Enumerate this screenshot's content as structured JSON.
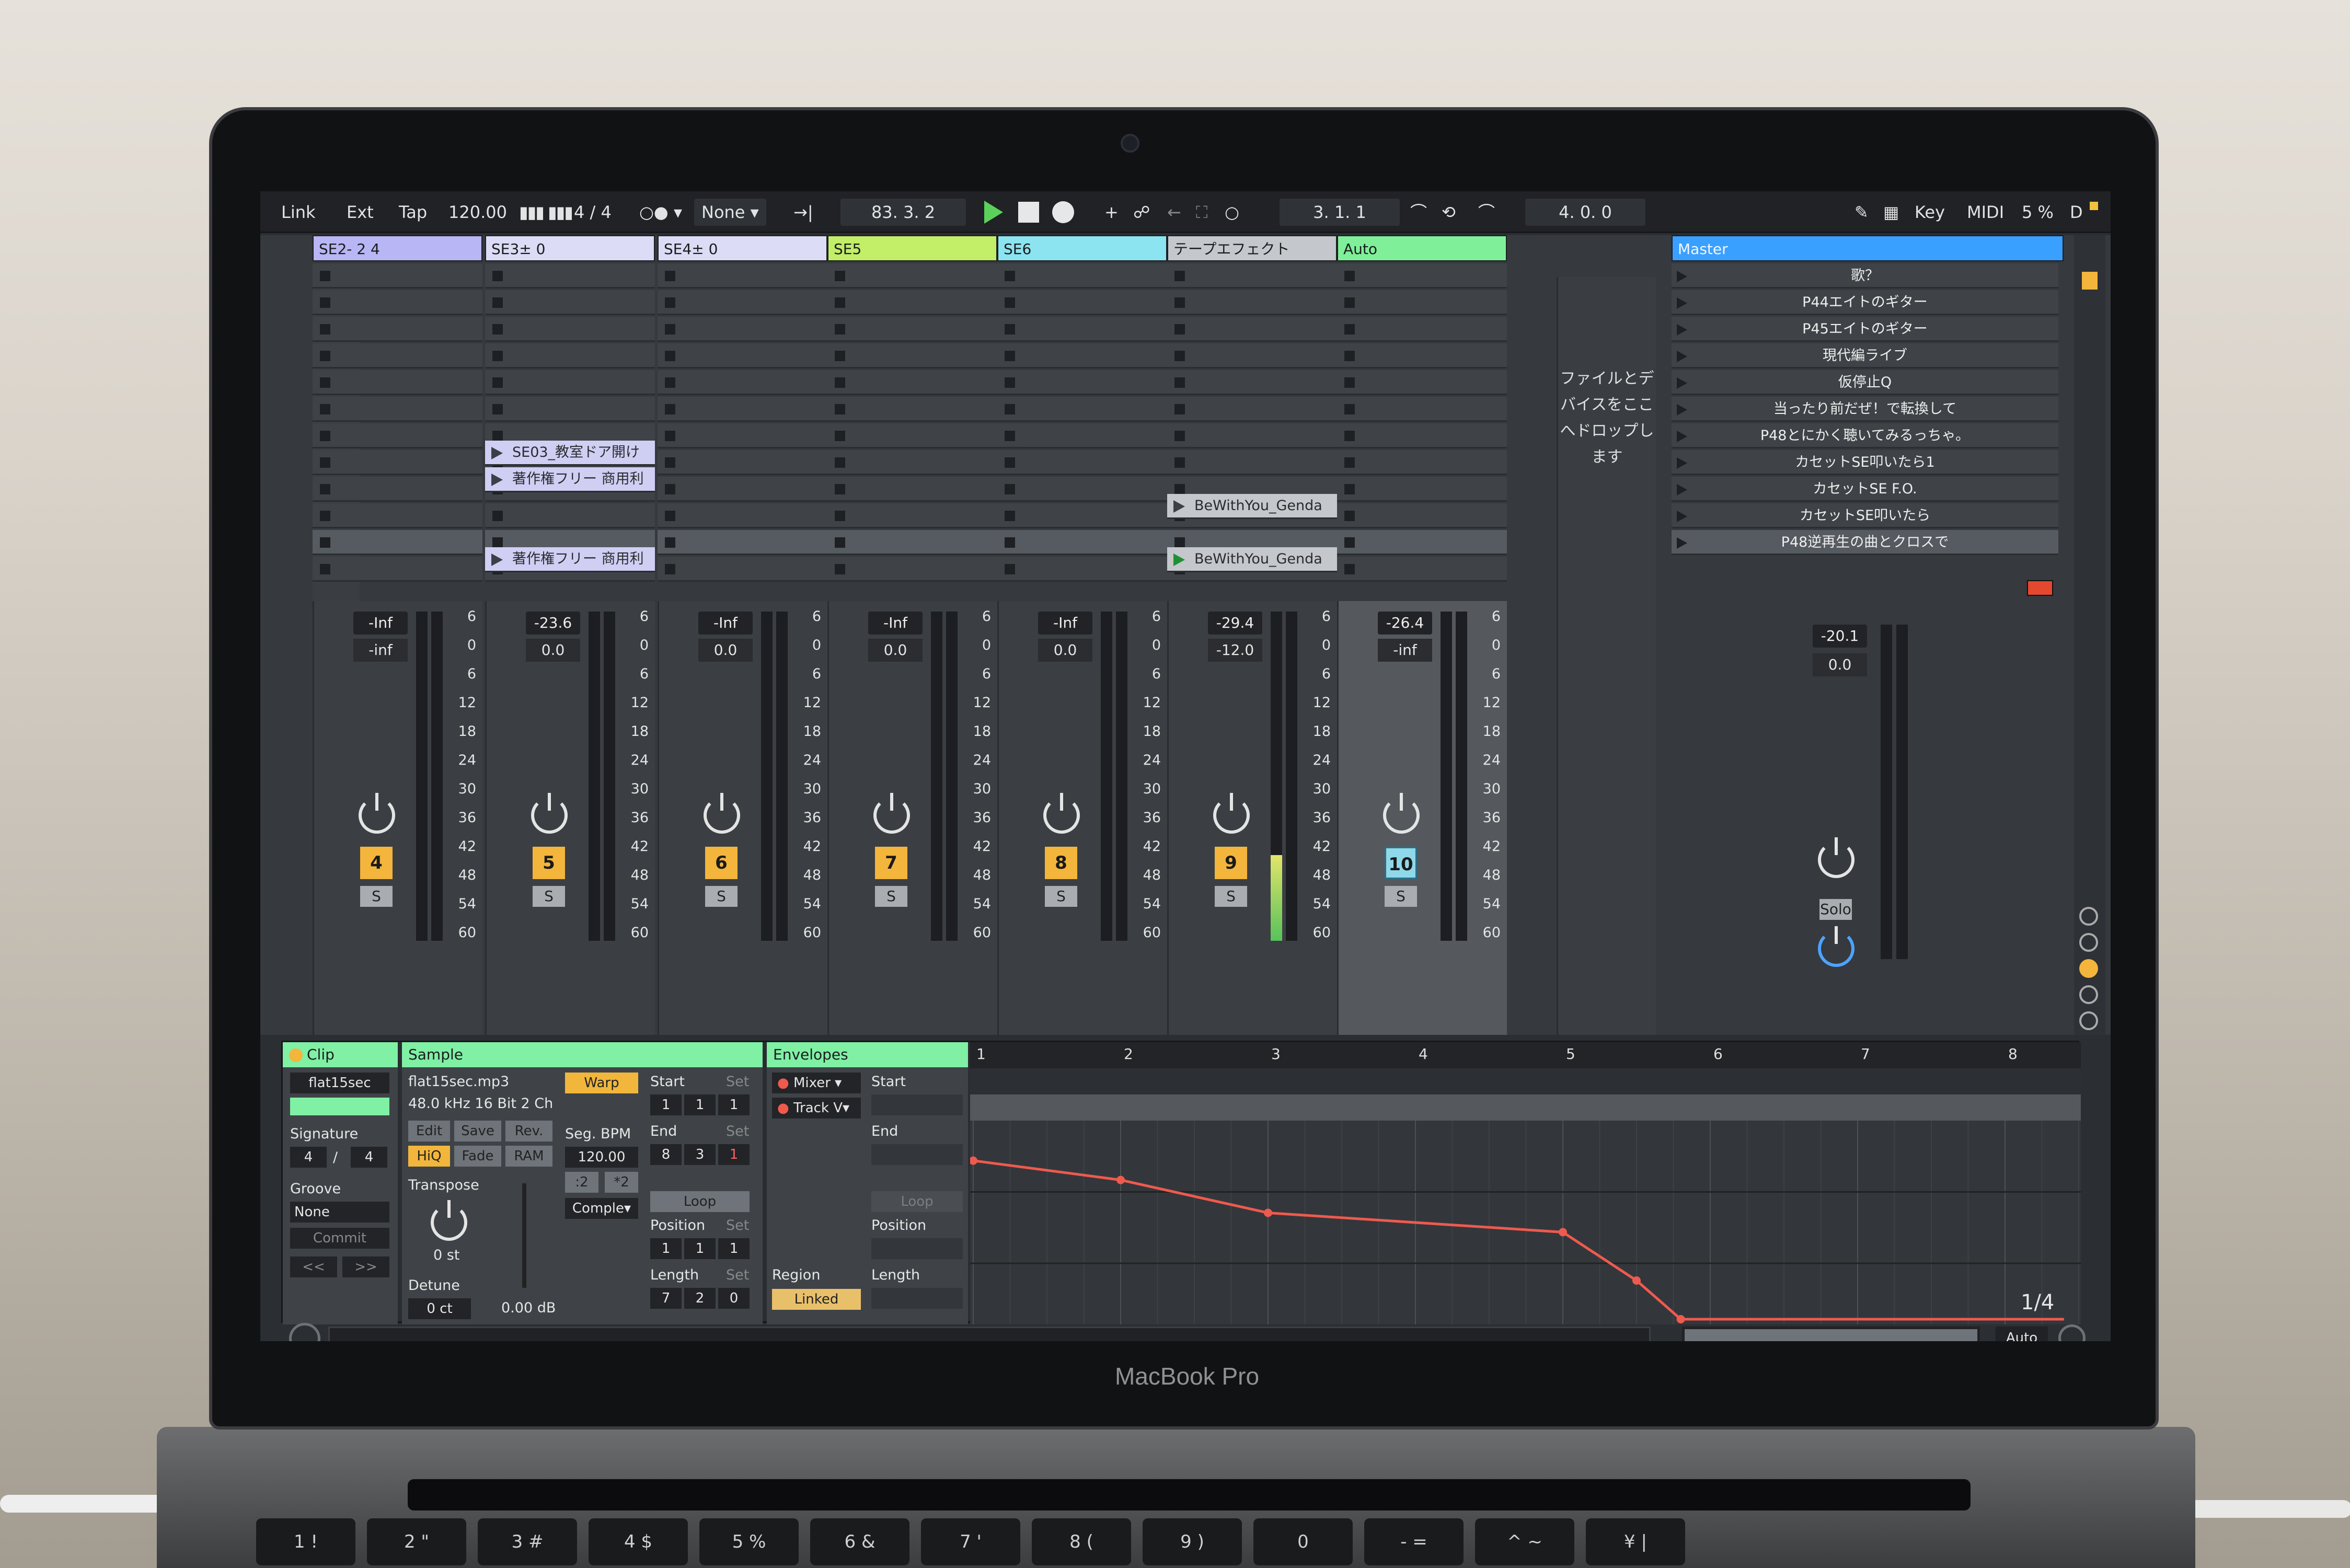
{
  "control_bar": {
    "link": "Link",
    "ext": "Ext",
    "tap": "Tap",
    "tempo": "120.00",
    "time_sig": "4 / 4",
    "quantize": "None",
    "arrangement_position": "83. 3. 2",
    "loop_start": "3. 1. 1",
    "loop_length": "4. 0. 0",
    "key": "Key",
    "midi": "MIDI",
    "cpu": "5 %",
    "disk": "D"
  },
  "tracks": [
    {
      "name": "SE2- 2 4",
      "color": "#b9b6f5",
      "number": "4",
      "vol_a": "-Inf",
      "vol_b": "-inf"
    },
    {
      "name": "SE3± 0",
      "color": "#dcdcf6",
      "number": "5",
      "vol_a": "-23.6",
      "vol_b": "0.0"
    },
    {
      "name": "SE4± 0",
      "color": "#dcdcf6",
      "number": "6",
      "vol_a": "-Inf",
      "vol_b": "0.0"
    },
    {
      "name": "SE5",
      "color": "#c2ee68",
      "number": "7",
      "vol_a": "-Inf",
      "vol_b": "0.0"
    },
    {
      "name": "SE6",
      "color": "#8ce4f1",
      "number": "8",
      "vol_a": "-Inf",
      "vol_b": "0.0"
    },
    {
      "name": "テープエフェクト",
      "color": "#c4c7cb",
      "number": "9",
      "vol_a": "-29.4",
      "vol_b": "-12.0"
    },
    {
      "name": "Auto",
      "color": "#7fef9a",
      "number": "10",
      "vol_a": "-26.4",
      "vol_b": "-inf"
    }
  ],
  "clips": [
    {
      "track": 1,
      "label": "SE03_教室ドア開け"
    },
    {
      "track": 1,
      "label": "著作権フリー 商用利"
    },
    {
      "track": 1,
      "label": "著作権フリー 商用利"
    },
    {
      "track": 5,
      "label": "BeWithYou_Genda"
    },
    {
      "track": 5,
      "label": "BeWithYou_Genda"
    }
  ],
  "scale_labels": [
    "6",
    "0",
    "6",
    "12",
    "18",
    "24",
    "30",
    "36",
    "42",
    "48",
    "54",
    "60"
  ],
  "dropzone_text": [
    "ファイルとデ",
    "バイスをここ",
    "へドロップし",
    "ます"
  ],
  "master": {
    "name": "Master",
    "vol_a": "-20.1",
    "vol_b": "0.0",
    "solo": "Solo",
    "scenes": [
      "歌？",
      "P44エイトのギター",
      "P45エイトのギター",
      "現代編ライブ",
      "仮停止Q",
      "当ったり前だぜ！で転換して",
      "P48とにかく聴いてみるっちゃ。",
      "カセットSE叩いたら1",
      "カセットSE F.O.",
      "カセットSE叩いたら",
      "P48逆再生の曲とクロスで"
    ]
  },
  "sends_label": "S",
  "clip_view": {
    "clip_header": "Clip",
    "clip_name": "flat15sec",
    "signature_label": "Signature",
    "sig_num": "4",
    "sig_slash": "/",
    "sig_den": "4",
    "groove_label": "Groove",
    "groove_value": "None",
    "commit": "Commit",
    "nav_prev": "<<",
    "nav_next": ">>",
    "sample_header": "Sample",
    "sample_file": "flat15sec.mp3",
    "sample_format": "48.0 kHz 16 Bit 2 Ch",
    "warp": "Warp",
    "edit": "Edit",
    "save": "Save",
    "rev": "Rev.",
    "hiq": "HiQ",
    "fade": "Fade",
    "ram": "RAM",
    "seg_bpm_label": "Seg. BPM",
    "seg_bpm": "120.00",
    "half": ":2",
    "double": "*2",
    "warp_mode": "Comple▾",
    "transpose_label": "Transpose",
    "transpose": "0 st",
    "detune_label": "Detune",
    "detune": "0 ct",
    "gain": "0.00 dB",
    "start_label": "Start",
    "start": [
      "1",
      "1",
      "1"
    ],
    "end_label": "End",
    "end": [
      "8",
      "3",
      "1"
    ],
    "loop": "Loop",
    "position_label": "Position",
    "position": [
      "1",
      "1",
      "1"
    ],
    "length_label": "Length",
    "length": [
      "7",
      "2",
      "0"
    ],
    "set": "Set",
    "envelopes_header": "Envelopes",
    "env_device": "Mixer",
    "env_param": "Track V",
    "region": "Region",
    "linked": "Linked",
    "env_start": "Start",
    "env_end": "End",
    "env_loop": "Loop",
    "env_position": "Position",
    "env_length": "Length",
    "ruler": [
      "1",
      "2",
      "3",
      "4",
      "5",
      "6",
      "7",
      "8"
    ],
    "zoom": "1/4",
    "auto": "Auto"
  },
  "envelope_points": [
    {
      "bar": 1.0,
      "level": 0.82
    },
    {
      "bar": 2.0,
      "level": 0.72
    },
    {
      "bar": 3.0,
      "level": 0.55
    },
    {
      "bar": 5.0,
      "level": 0.45
    },
    {
      "bar": 5.5,
      "level": 0.2
    },
    {
      "bar": 5.8,
      "level": 0.0
    },
    {
      "bar": 8.4,
      "level": 0.0
    }
  ],
  "laptop_brand": "MacBook Pro",
  "colors": {
    "accent_green": "#5bd15b",
    "clip_yellow": "#f1b63b",
    "header_green": "#7ff0a4",
    "master_blue": "#3aa0ff",
    "envelope_red": "#ef5a4e"
  }
}
